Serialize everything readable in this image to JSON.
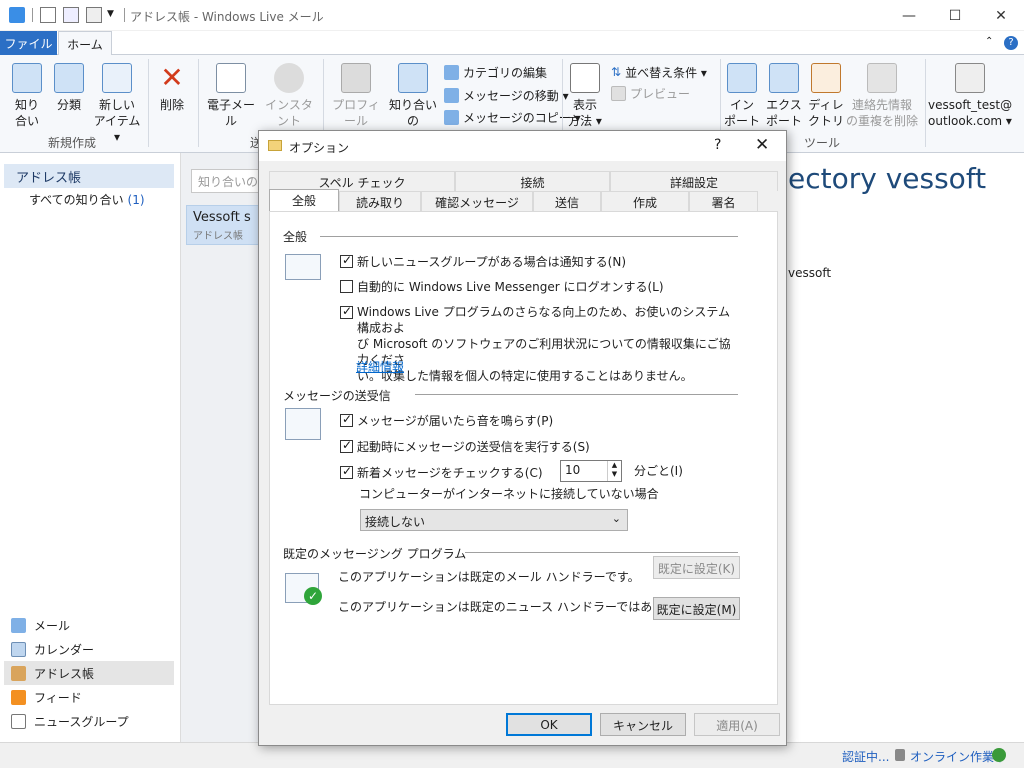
{
  "window": {
    "title": "アドレス帳 - Windows Live メール",
    "minimize": "—",
    "maximize": "☐",
    "close": "✕"
  },
  "ribbon_tabs": {
    "file": "ファイル",
    "home": "ホーム",
    "help": "?"
  },
  "ribbon": {
    "contact": "知り\n合い",
    "category": "分類",
    "new_item": "新しい\nアイテム ▾",
    "group_new": "新規作成",
    "delete": "削除",
    "email": "電子メール",
    "im": "インスタント\nメッセージ",
    "group_send": "送",
    "profile": "プロフィール\nの表示",
    "edit_contact": "知り合いの\n編集",
    "edit_category": "カテゴリの編集",
    "move_message": "メッセージの移動 ▾",
    "copy_message": "メッセージのコピー ▾",
    "view": "表示\n方法 ▾",
    "sort": "並べ替え条件 ▾",
    "preview": "プレビュー",
    "import": "イン\nポート ▾",
    "export": "エクス\nポート ▾",
    "directory": "ディレ\nクトリ",
    "dedupe": "連絡先情報\nの重複を削除",
    "group_tools": "ツール",
    "account": "vessoft_test@\noutlook.com ▾"
  },
  "left": {
    "header": "アドレス帳",
    "all_contacts": "すべての知り合い",
    "all_count": "(1)",
    "nav": [
      "メール",
      "カレンダー",
      "アドレス帳",
      "フィード",
      "ニュースグループ"
    ]
  },
  "middle": {
    "search_placeholder": "知り合いの検",
    "contact_name": "Vessoft s",
    "contact_sub": "アドレス帳"
  },
  "right": {
    "big": "ectory vessoft",
    "small": "vessoft"
  },
  "status": {
    "auth": "認証中...",
    "online": "オンライン作業中"
  },
  "dialog": {
    "title": "オプション",
    "help": "?",
    "close": "✕",
    "tabs_row1": [
      "スペル チェック",
      "接続",
      "詳細設定"
    ],
    "tabs_row2": [
      "全般",
      "読み取り",
      "確認メッセージ",
      "送信",
      "作成",
      "署名"
    ],
    "section_general": "全般",
    "chk_newsgroup": "新しいニュースグループがある場合は通知する(N)",
    "chk_messenger": "自動的に Windows Live Messenger にログオンする(L)",
    "improve_text": "Windows Live プログラムのさらなる向上のため、お使いのシステム構成およ\nび Microsoft のソフトウェアのご利用状況についての情報収集にご協力くださ\nい。収集した情報を個人の特定に使用することはありません。",
    "detail_link": "詳細情報",
    "section_send": "メッセージの送受信",
    "chk_sound": "メッセージが届いたら音を鳴らす(P)",
    "chk_sendrecv": "起動時にメッセージの送受信を実行する(S)",
    "chk_check": "新着メッセージをチェックする(C)",
    "interval": "10",
    "interval_unit": "分ごと(I)",
    "offline_label": "コンピューターがインターネットに接続していない場合",
    "offline_select": "接続しない",
    "section_default": "既定のメッセージング プログラム",
    "mail_handler": "このアプリケーションは既定のメール ハンドラーです。",
    "news_handler": "このアプリケーションは既定のニュース ハンドラーではありません。",
    "set_default_k": "既定に設定(K)",
    "set_default_m": "既定に設定(M)",
    "ok": "OK",
    "cancel": "キャンセル",
    "apply": "適用(A)"
  }
}
